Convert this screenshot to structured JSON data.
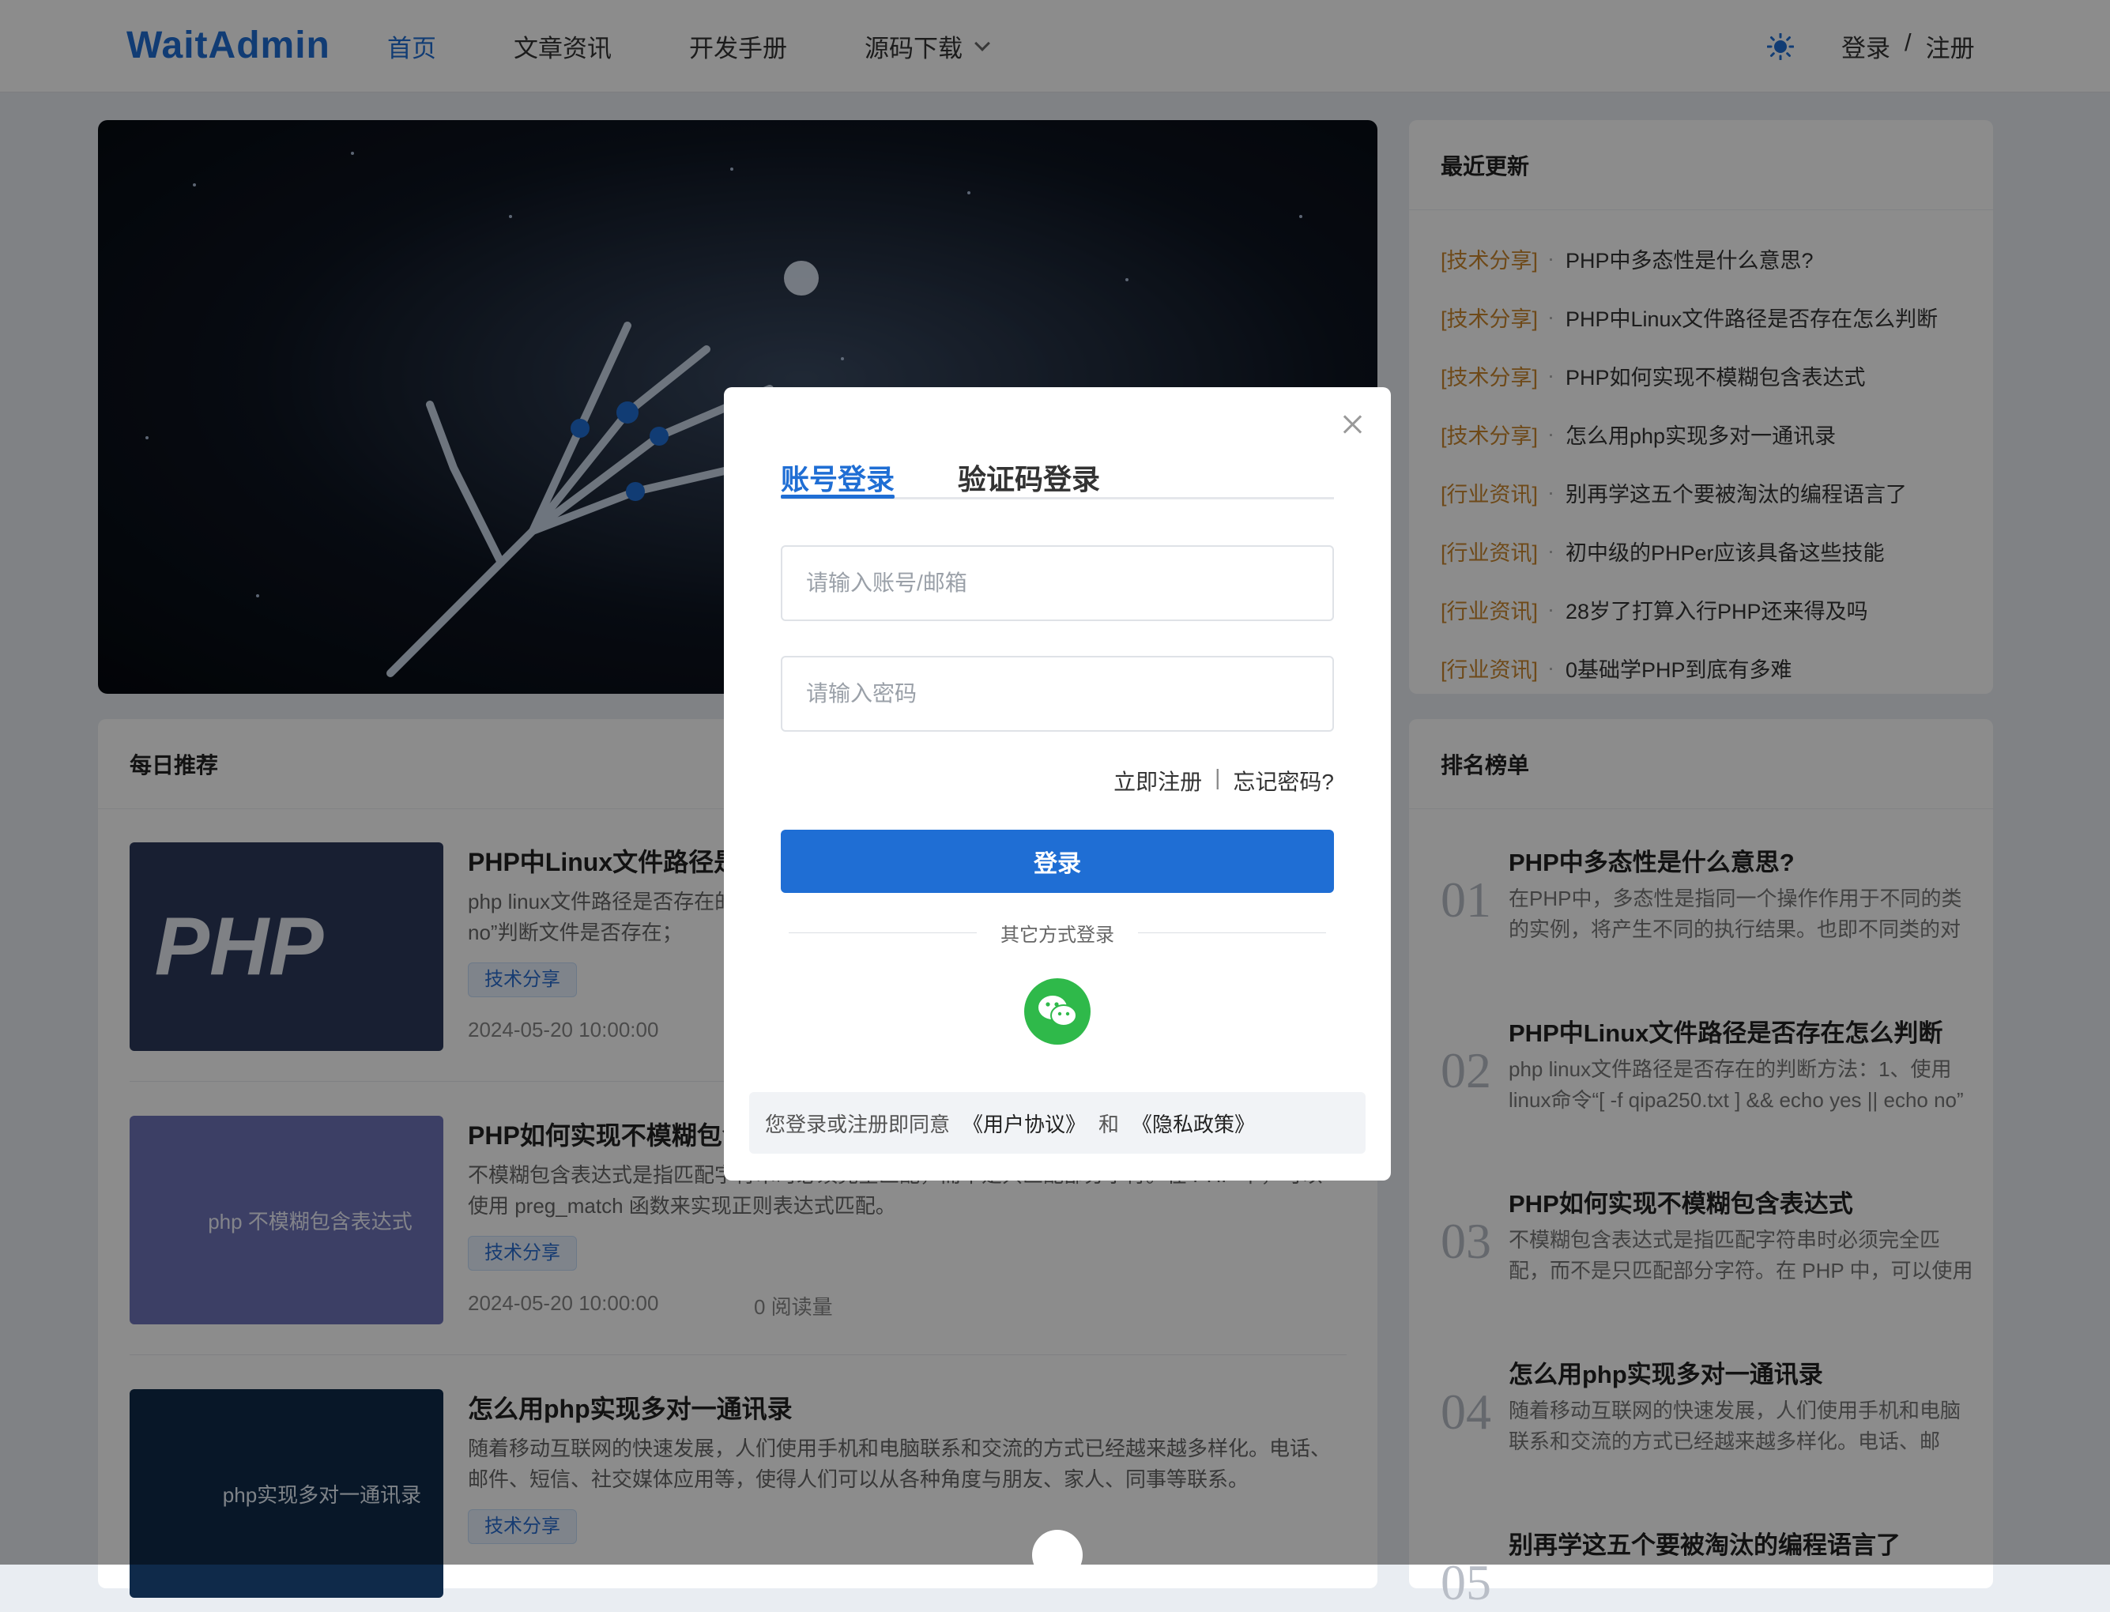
{
  "header": {
    "logo": "WaitAdmin",
    "nav": [
      {
        "label": "首页",
        "active": true
      },
      {
        "label": "文章资讯",
        "active": false
      },
      {
        "label": "开发手册",
        "active": false
      },
      {
        "label": "源码下载",
        "active": false
      }
    ],
    "login": "登录",
    "slash": "/",
    "register": "注册",
    "theme_icon": "sun-icon"
  },
  "recent": {
    "title": "最近更新",
    "items": [
      {
        "cat": "[技术分享]",
        "dot": "·",
        "title": "PHP中多态性是什么意思?"
      },
      {
        "cat": "[技术分享]",
        "dot": "·",
        "title": "PHP中Linux文件路径是否存在怎么判断"
      },
      {
        "cat": "[技术分享]",
        "dot": "·",
        "title": "PHP如何实现不模糊包含表达式"
      },
      {
        "cat": "[技术分享]",
        "dot": "·",
        "title": "怎么用php实现多对一通讯录"
      },
      {
        "cat": "[行业资讯]",
        "dot": "·",
        "title": "别再学这五个要被淘汰的编程语言了"
      },
      {
        "cat": "[行业资讯]",
        "dot": "·",
        "title": "初中级的PHPer应该具备这些技能"
      },
      {
        "cat": "[行业资讯]",
        "dot": "·",
        "title": "28岁了打算入行PHP还来得及吗"
      },
      {
        "cat": "[行业资讯]",
        "dot": "·",
        "title": "0基础学PHP到底有多难"
      }
    ]
  },
  "daily": {
    "title": "每日推荐",
    "articles": [
      {
        "thumb_text": "PHP",
        "title": "PHP中Linux文件路径是否存在怎么判断",
        "desc": "php linux文件路径是否存在的判断方法：1、使用linux命令“[ -f qipa250.txt ] && echo yes || echo no”判断文件是否存在；",
        "tag": "技术分享",
        "date": "2024-05-20 10:00:00",
        "reads": ""
      },
      {
        "thumb_text": "php   不模糊包含表达式",
        "title": "PHP如何实现不模糊包含表达式",
        "desc": "不模糊包含表达式是指匹配字符串时必须完全匹配，而不是只匹配部分字符。在 PHP 中，可以使用 preg_match 函数来实现正则表达式匹配。",
        "tag": "技术分享",
        "date": "2024-05-20 10:00:00",
        "reads": "0 阅读量"
      },
      {
        "thumb_text": "php实现多对一通讯录",
        "title": "怎么用php实现多对一通讯录",
        "desc": "随着移动互联网的快速发展，人们使用手机和电脑联系和交流的方式已经越来越多样化。电话、邮件、短信、社交媒体应用等，使得人们可以从各种角度与朋友、家人、同事等联系。",
        "tag": "技术分享",
        "date": "",
        "reads": ""
      }
    ]
  },
  "ranking": {
    "title": "排名榜单",
    "items": [
      {
        "num": "01",
        "title": "PHP中多态性是什么意思?",
        "desc": "在PHP中，多态性是指同一个操作作用于不同的类的实例，将产生不同的执行结果。也即不同类的对象收到相同消息时，将得到不同的结果。"
      },
      {
        "num": "02",
        "title": "PHP中Linux文件路径是否存在怎么判断",
        "desc": "php linux文件路径是否存在的判断方法：1、使用linux命令“[ -f qipa250.txt ] && echo yes || echo no”"
      },
      {
        "num": "03",
        "title": "PHP如何实现不模糊包含表达式",
        "desc": "不模糊包含表达式是指匹配字符串时必须完全匹配，而不是只匹配部分字符。在 PHP 中，可以使用 preg_match 函数"
      },
      {
        "num": "04",
        "title": "怎么用php实现多对一通讯录",
        "desc": "随着移动互联网的快速发展，人们使用手机和电脑联系和交流的方式已经越来越多样化。电话、邮件、短信"
      },
      {
        "num": "05",
        "title": "别再学这五个要被淘汰的编程语言了",
        "desc": ""
      }
    ]
  },
  "modal": {
    "tab_account": "账号登录",
    "tab_code": "验证码登录",
    "account_placeholder": "请输入账号/邮箱",
    "password_placeholder": "请输入密码",
    "register_link": "立即注册",
    "link_sep": "|",
    "forgot_link": "忘记密码?",
    "login_button": "登录",
    "other_methods": "其它方式登录",
    "agree_prefix": "您登录或注册即同意",
    "user_agreement": "《用户协议》",
    "and": "和",
    "privacy_policy": "《隐私政策》",
    "wechat_icon": "wechat-icon",
    "close_icon": "close-icon"
  },
  "colors": {
    "primary": "#1f6ed4",
    "category": "#c8862c",
    "wechat": "#2fb94a"
  }
}
